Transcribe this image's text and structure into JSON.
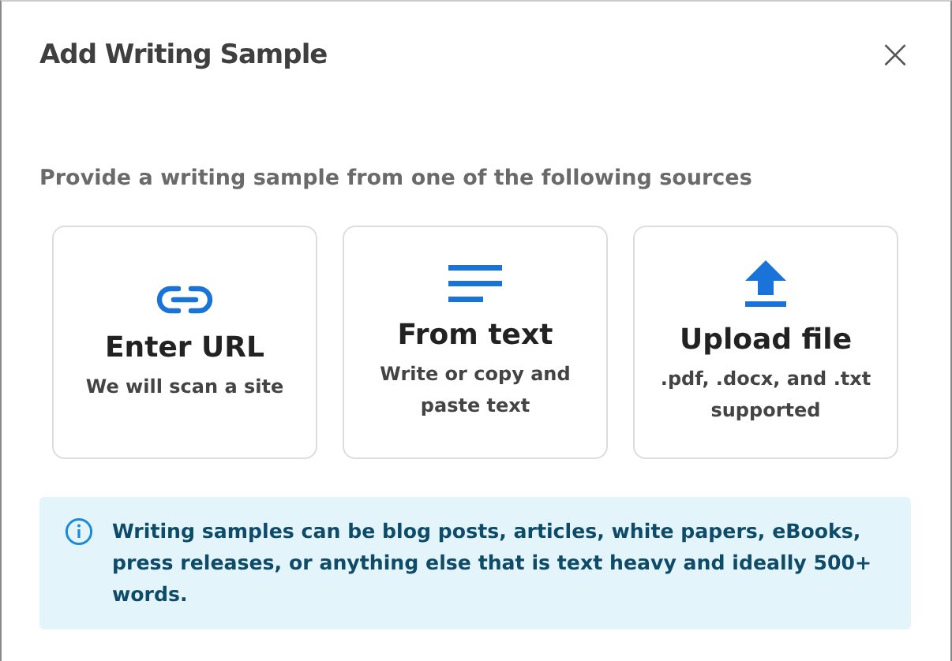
{
  "dialog": {
    "title": "Add Writing Sample",
    "close": "×"
  },
  "prompt": "Provide a writing sample from one of the following sources",
  "options": [
    {
      "kind": "link",
      "title": "Enter URL",
      "subtitle": "We will scan a site"
    },
    {
      "kind": "lines",
      "title": "From text",
      "subtitle": "Write or copy and paste text"
    },
    {
      "kind": "upload",
      "title": "Upload file",
      "subtitle": ".pdf, .docx, and .txt supported"
    }
  ],
  "info": {
    "text": "Writing samples can be blog posts, articles, white papers, eBooks, press releases, or anything else that is text heavy and ideally 500+ words."
  }
}
